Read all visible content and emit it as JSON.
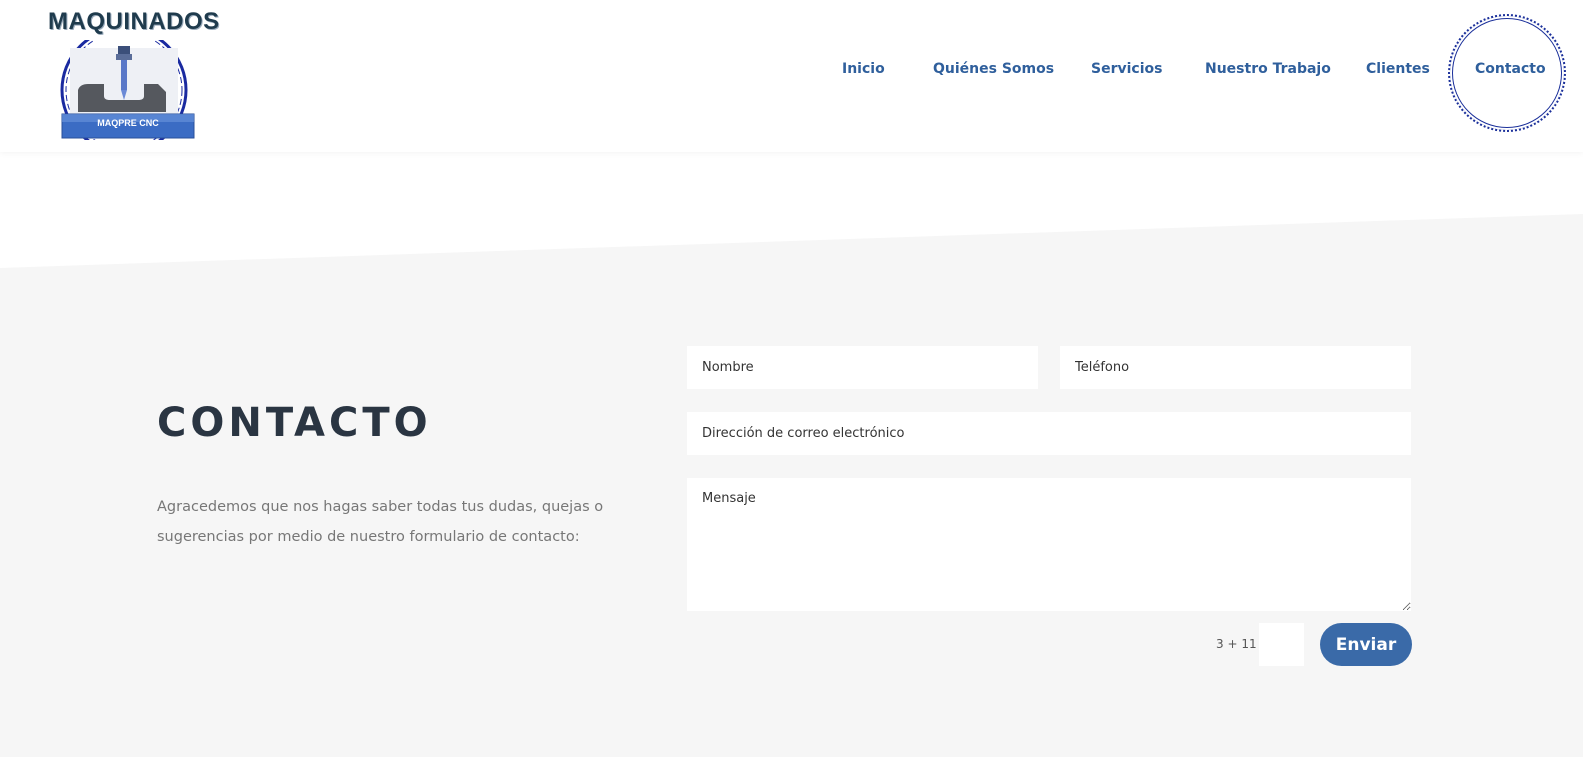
{
  "brand": {
    "title": "MAQUINADOS",
    "logo_caption": "MAQPRE CNC"
  },
  "nav": {
    "items": [
      {
        "label": "Inicio"
      },
      {
        "label": "Quiénes Somos"
      },
      {
        "label": "Servicios"
      },
      {
        "label": "Nuestro Trabajo"
      },
      {
        "label": "Clientes"
      },
      {
        "label": "Contacto"
      }
    ],
    "active": "Contacto"
  },
  "contact": {
    "title": "CONTACTO",
    "description": "Agracedemos que nos hagas saber todas tus dudas, quejas o sugerencias por medio de nuestro formulario de contacto:"
  },
  "form": {
    "name_placeholder": "Nombre",
    "phone_placeholder": "Teléfono",
    "email_placeholder": "Dirección de correo electrónico",
    "message_placeholder": "Mensaje",
    "captcha_question": "3 + 11 =",
    "captcha_value": "",
    "submit_label": "Enviar"
  },
  "colors": {
    "nav_text": "#2f5f9c",
    "button_bg": "#3a6aa8",
    "ring": "#1a2f9a",
    "page_bg": "#f6f6f6"
  }
}
